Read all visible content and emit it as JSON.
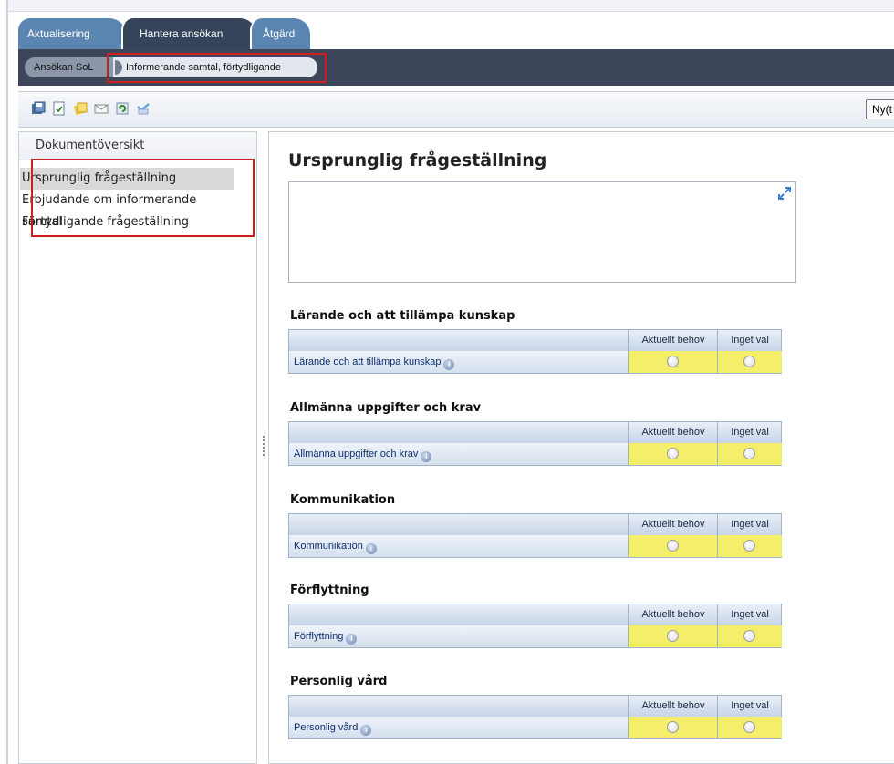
{
  "workflow_tabs": [
    "Aktualisering",
    "Hantera ansökan",
    "Åtgärd"
  ],
  "sub_tabs": [
    "Ansökan SoL",
    "Informerande samtal, förtydligande"
  ],
  "toolbar": {
    "icons": [
      "save-icon",
      "checklist-icon",
      "notes-icon",
      "mail-icon",
      "refresh-icon",
      "approve-icon"
    ],
    "new_button": "Ny(t"
  },
  "document_overview": {
    "title": "Dokumentöversikt",
    "items": [
      "Ursprunglig frågeställning",
      "Erbjudande om informerande samtal",
      "Förtydligande frågeställning"
    ],
    "selected_index": 0
  },
  "main": {
    "title": "Ursprunglig frågeställning",
    "text_value": "",
    "column_headers": [
      "Aktuellt behov",
      "Inget val"
    ],
    "sections": [
      {
        "title": "Lärande och att tillämpa kunskap",
        "row_label": "Lärande och att tillämpa kunskap"
      },
      {
        "title": "Allmänna uppgifter och krav",
        "row_label": "Allmänna uppgifter och krav"
      },
      {
        "title": "Kommunikation",
        "row_label": "Kommunikation"
      },
      {
        "title": "Förflyttning",
        "row_label": "Förflyttning"
      },
      {
        "title": "Personlig vård",
        "row_label": "Personlig vård"
      }
    ]
  },
  "colors": {
    "active_tab": "#35445a",
    "inactive_tab": "#5b86b1",
    "highlight_box": "#cc1f1f",
    "cell_yellow": "#f5ee6a"
  }
}
